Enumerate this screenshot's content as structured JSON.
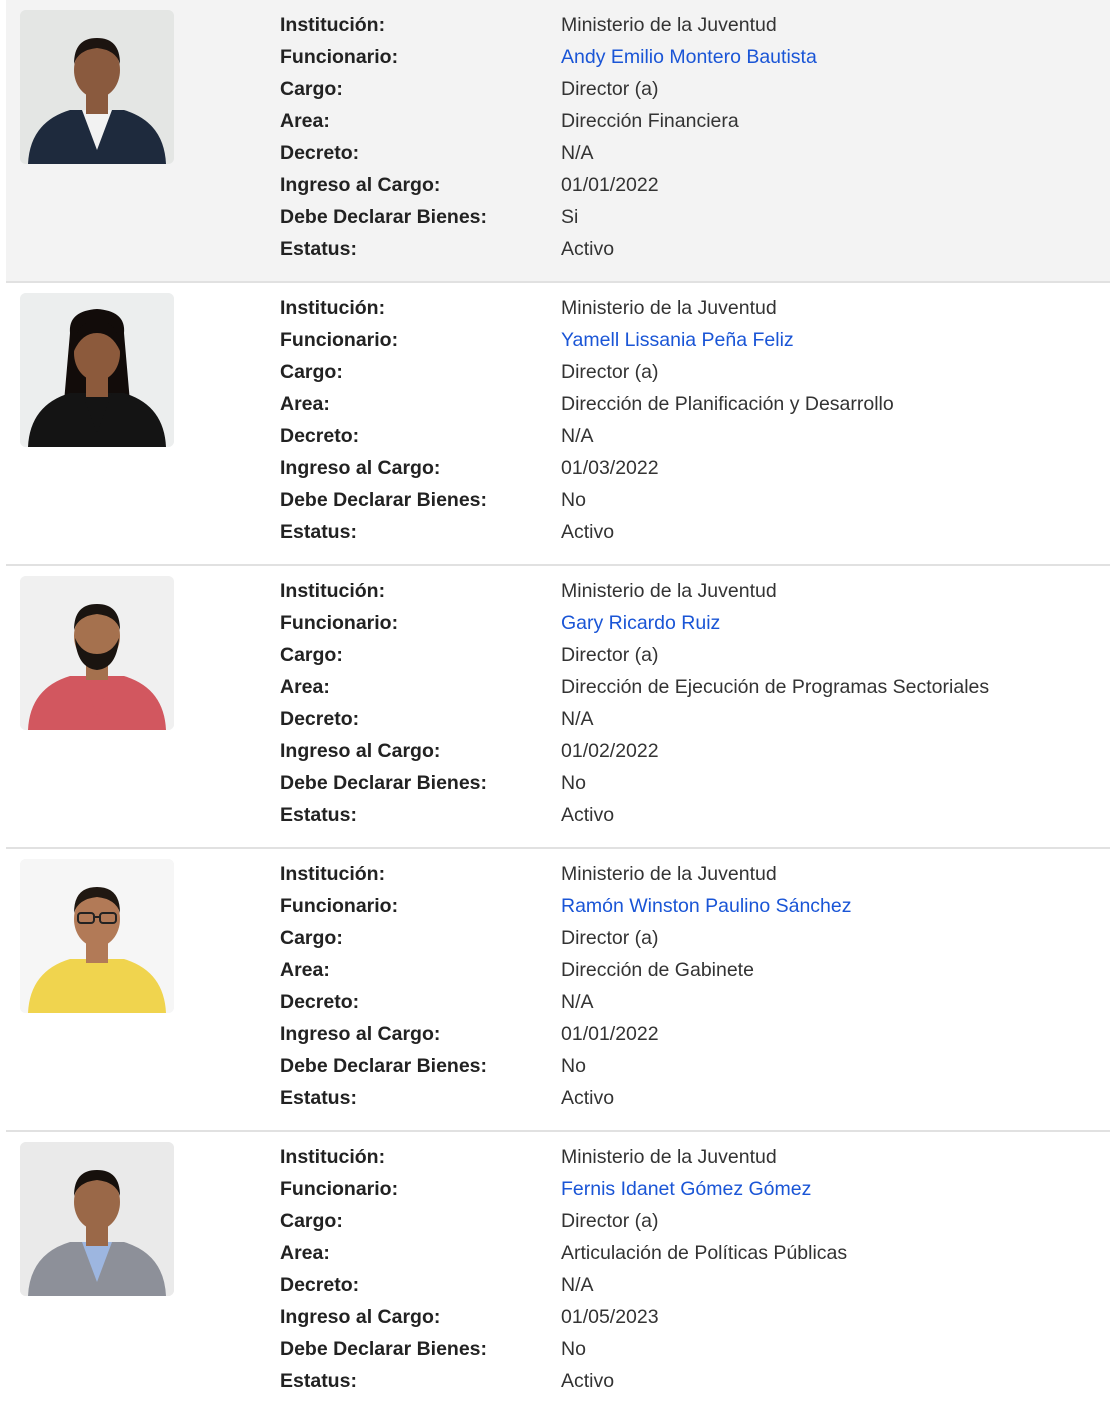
{
  "labels": {
    "institucion": "Institución:",
    "funcionario": "Funcionario:",
    "cargo": "Cargo:",
    "area": "Area:",
    "decreto": "Decreto:",
    "ingreso": "Ingreso al Cargo:",
    "declarar": "Debe Declarar Bienes:",
    "estatus": "Estatus:"
  },
  "colors": {
    "link": "#1a55d6",
    "row_shaded": "#f3f3f3",
    "divider": "#e1e1e1"
  },
  "officials": [
    {
      "institucion": "Ministerio de la Juventud",
      "funcionario": "Andy Emilio Montero Bautista",
      "cargo": "Director (a)",
      "area": "Dirección Financiera",
      "decreto": "N/A",
      "ingreso": "01/01/2022",
      "declarar": "Si",
      "estatus": "Activo",
      "photo": {
        "bg": "#e4e6e4",
        "skin": "#8a5a3e",
        "hair": "#1c1410",
        "clothes": "#1e2a3d",
        "shirt": "#f2f2f2",
        "beard": false,
        "glasses": false
      }
    },
    {
      "institucion": "Ministerio de la Juventud",
      "funcionario": "Yamell Lissania Peña Feliz",
      "cargo": "Director (a)",
      "area": "Dirección de Planificación y Desarrollo",
      "decreto": "N/A",
      "ingreso": "01/03/2022",
      "declarar": "No",
      "estatus": "Activo",
      "photo": {
        "bg": "#eceeee",
        "skin": "#8c5a3c",
        "hair": "#120c0a",
        "clothes": "#141414",
        "shirt": "#141414",
        "beard": false,
        "glasses": false,
        "longhair": true
      }
    },
    {
      "institucion": "Ministerio de la Juventud",
      "funcionario": "Gary Ricardo Ruiz",
      "cargo": "Director (a)",
      "area": "Dirección de Ejecución de Programas Sectoriales",
      "decreto": "N/A",
      "ingreso": "01/02/2022",
      "declarar": "No",
      "estatus": "Activo",
      "photo": {
        "bg": "#f0f0f0",
        "skin": "#a5714e",
        "hair": "#1a1410",
        "clothes": "#d2575f",
        "shirt": "#d2575f",
        "beard": true,
        "glasses": false
      }
    },
    {
      "institucion": "Ministerio de la Juventud",
      "funcionario": "Ramón Winston Paulino Sánchez",
      "cargo": "Director (a)",
      "area": "Dirección de Gabinete",
      "decreto": "N/A",
      "ingreso": "01/01/2022",
      "declarar": "No",
      "estatus": "Activo",
      "photo": {
        "bg": "#f6f6f6",
        "skin": "#b27a57",
        "hair": "#201812",
        "clothes": "#f0d44e",
        "shirt": "#f0d44e",
        "beard": false,
        "glasses": true
      }
    },
    {
      "institucion": "Ministerio de la Juventud",
      "funcionario": "Fernis Idanet Gómez Gómez",
      "cargo": "Director (a)",
      "area": "Articulación de Políticas Públicas",
      "decreto": "N/A",
      "ingreso": "01/05/2023",
      "declarar": "No",
      "estatus": "Activo",
      "photo": {
        "bg": "#eaeaea",
        "skin": "#9a6848",
        "hair": "#16100c",
        "clothes": "#8d9099",
        "shirt": "#9db6e0",
        "beard": false,
        "glasses": false
      }
    }
  ]
}
